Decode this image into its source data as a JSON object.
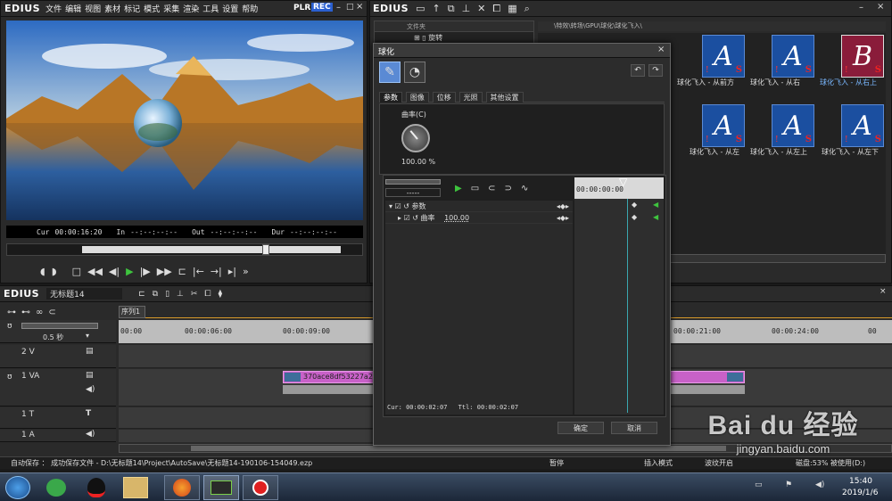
{
  "player": {
    "logo": "EDIUS",
    "menu": [
      "文件",
      "编辑",
      "视图",
      "素材",
      "标记",
      "模式",
      "采集",
      "渲染",
      "工具",
      "设置",
      "帮助"
    ],
    "plr": "PLR",
    "rec": "REC",
    "cur_label": "Cur",
    "cur_value": "00:00:16:20",
    "in_label": "In",
    "in_value": "--:--:--:--",
    "out_label": "Out",
    "out_value": "--:--:--:--",
    "dur_label": "Dur",
    "dur_value": "--:--:--:--"
  },
  "bin": {
    "logo": "EDIUS",
    "folder_header": "文件夹",
    "folder_item": "旋转",
    "path": "\\特效\\转场\\GPU\\球化\\球化飞入\\",
    "items": [
      {
        "letter": "A",
        "label": "球化飞入 - 从前方",
        "selected": false
      },
      {
        "letter": "A",
        "label": "球化飞入 - 从右",
        "selected": false
      },
      {
        "letter": "B",
        "label": "球化飞入 - 从右上",
        "selected": true
      },
      {
        "letter": "A",
        "label": "球化飞入 - 从左",
        "selected": false
      },
      {
        "letter": "A",
        "label": "球化飞入 - 从左上",
        "selected": false
      },
      {
        "letter": "A",
        "label": "球化飞入 - 从左下",
        "selected": false
      }
    ]
  },
  "timeline": {
    "logo": "EDIUS",
    "project": "无标题14",
    "sequence_tab": "序列1",
    "zoom": "0.5 秒",
    "ruler": [
      "00:00",
      "00:00:06:00",
      "00:00:09:00",
      "00:00:21:00",
      "00:00:24:00",
      "00"
    ],
    "tracks": [
      {
        "name": "2 V"
      },
      {
        "name": "1 VA"
      },
      {
        "name": "1 T"
      },
      {
        "name": "1 A"
      }
    ],
    "clip_name": "370ace8df53227a2"
  },
  "dialog": {
    "title": "球化",
    "tabs": [
      "参数",
      "图像",
      "位移",
      "光照",
      "其他设置"
    ],
    "param_label": "曲率(C)",
    "param_value": "100.00 %",
    "dropdown": "-----",
    "tree": [
      {
        "label": "参数",
        "value": ""
      },
      {
        "label": "曲率",
        "value": "100.00"
      }
    ],
    "kf_time": "00:00:00:00",
    "cur": "Cur: 00:00:02:07",
    "ttl": "Ttl: 00:00:02:07",
    "ok": "确定",
    "cancel": "取消"
  },
  "status": {
    "autosave": "自动保存 ： 成功保存文件 - D:\\无标题14\\Project\\AutoSave\\无标题14-190106-154049.ezp",
    "pause": "暂停",
    "mode": "插入模式",
    "ripple": "波纹开启",
    "disk": "磁盘:53% 被使用(D:)"
  },
  "taskbar": {
    "time": "15:40",
    "date": "2019/1/6"
  },
  "watermark": {
    "brand": "Bai du 经验",
    "url": "jingyan.baidu.com"
  },
  "colors": {
    "accent_blue": "#1b4fa0",
    "clip_pink": "#c861c8",
    "play_green": "#3ec43e",
    "rec_blue": "#2a5fd0"
  }
}
